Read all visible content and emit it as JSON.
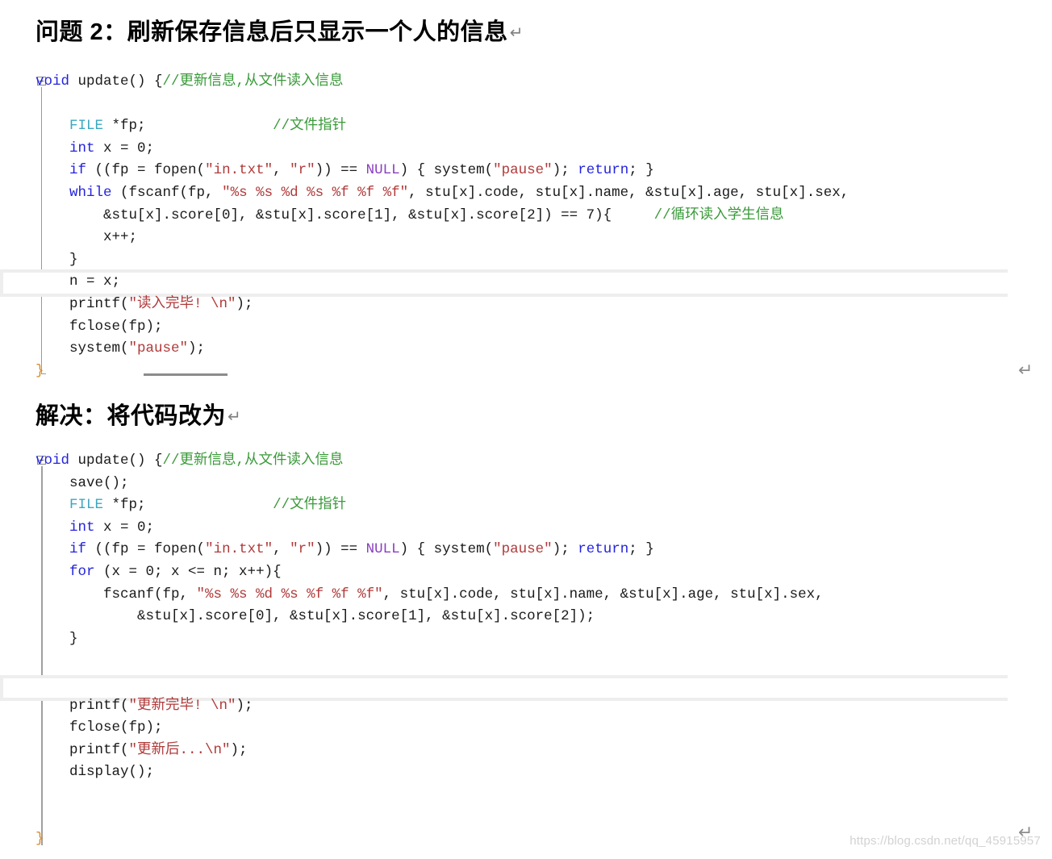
{
  "document": {
    "watermark": "https://blog.csdn.net/qq_45915957",
    "return_mark": "↵"
  },
  "headings": {
    "problem": "问题 2：刷新保存信息后只显示一个人的信息",
    "solution": "解决：将代码改为"
  },
  "code_block_1": {
    "name": "original-update-function",
    "lines": [
      [
        {
          "t": "void",
          "c": "kw"
        },
        {
          "t": " update() {",
          "c": "plain"
        },
        {
          "t": "//更新信息,从文件读入信息",
          "c": "cmt"
        }
      ],
      [],
      [
        {
          "t": "    ",
          "c": "plain"
        },
        {
          "t": "FILE",
          "c": "type"
        },
        {
          "t": " *fp;               ",
          "c": "plain"
        },
        {
          "t": "//文件指针",
          "c": "cmt"
        }
      ],
      [
        {
          "t": "    ",
          "c": "plain"
        },
        {
          "t": "int",
          "c": "kw"
        },
        {
          "t": " x = 0;",
          "c": "plain"
        }
      ],
      [
        {
          "t": "    ",
          "c": "plain"
        },
        {
          "t": "if",
          "c": "kw"
        },
        {
          "t": " ((fp = fopen(",
          "c": "plain"
        },
        {
          "t": "\"in.txt\"",
          "c": "str"
        },
        {
          "t": ", ",
          "c": "plain"
        },
        {
          "t": "\"r\"",
          "c": "str"
        },
        {
          "t": ")) == ",
          "c": "plain"
        },
        {
          "t": "NULL",
          "c": "macro"
        },
        {
          "t": ") { system(",
          "c": "plain"
        },
        {
          "t": "\"pause\"",
          "c": "str"
        },
        {
          "t": "); ",
          "c": "plain"
        },
        {
          "t": "return",
          "c": "kw"
        },
        {
          "t": "; }",
          "c": "plain"
        }
      ],
      [
        {
          "t": "    ",
          "c": "plain"
        },
        {
          "t": "while",
          "c": "kw"
        },
        {
          "t": " (fscanf(fp, ",
          "c": "plain"
        },
        {
          "t": "\"%s %s %d %s %f %f %f\"",
          "c": "str"
        },
        {
          "t": ", stu[x].code, stu[x].name, &stu[x].age, stu[x].sex,",
          "c": "plain"
        }
      ],
      [
        {
          "t": "        &stu[x].score[0], &stu[x].score[1], &stu[x].score[2]) == 7){     ",
          "c": "plain"
        },
        {
          "t": "//循环读入学生信息",
          "c": "cmt"
        }
      ],
      [
        {
          "t": "        x++;",
          "c": "plain"
        }
      ],
      [
        {
          "t": "    }",
          "c": "plain"
        }
      ],
      [
        {
          "t": "    n = x;",
          "c": "plain"
        }
      ],
      [
        {
          "t": "    printf(",
          "c": "plain"
        },
        {
          "t": "\"读入完毕! \\n\"",
          "c": "str"
        },
        {
          "t": ");",
          "c": "plain"
        }
      ],
      [
        {
          "t": "    fclose(fp);",
          "c": "plain"
        }
      ],
      [
        {
          "t": "    system(",
          "c": "plain"
        },
        {
          "t": "\"pause\"",
          "c": "str"
        },
        {
          "t": ");",
          "c": "plain"
        }
      ],
      [
        {
          "t": "}",
          "c": "brace"
        }
      ]
    ],
    "highlighted_line_index": 9,
    "highlighted_line_text": "n = x;"
  },
  "code_block_2": {
    "name": "fixed-update-function",
    "lines": [
      [
        {
          "t": "void",
          "c": "kw"
        },
        {
          "t": " update() {",
          "c": "plain"
        },
        {
          "t": "//更新信息,从文件读入信息",
          "c": "cmt"
        }
      ],
      [
        {
          "t": "    save();",
          "c": "plain"
        }
      ],
      [
        {
          "t": "    ",
          "c": "plain"
        },
        {
          "t": "FILE",
          "c": "type"
        },
        {
          "t": " *fp;               ",
          "c": "plain"
        },
        {
          "t": "//文件指针",
          "c": "cmt"
        }
      ],
      [
        {
          "t": "    ",
          "c": "plain"
        },
        {
          "t": "int",
          "c": "kw"
        },
        {
          "t": " x = 0;",
          "c": "plain"
        }
      ],
      [
        {
          "t": "    ",
          "c": "plain"
        },
        {
          "t": "if",
          "c": "kw"
        },
        {
          "t": " ((fp = fopen(",
          "c": "plain"
        },
        {
          "t": "\"in.txt\"",
          "c": "str"
        },
        {
          "t": ", ",
          "c": "plain"
        },
        {
          "t": "\"r\"",
          "c": "str"
        },
        {
          "t": ")) == ",
          "c": "plain"
        },
        {
          "t": "NULL",
          "c": "macro"
        },
        {
          "t": ") { system(",
          "c": "plain"
        },
        {
          "t": "\"pause\"",
          "c": "str"
        },
        {
          "t": "); ",
          "c": "plain"
        },
        {
          "t": "return",
          "c": "kw"
        },
        {
          "t": "; }",
          "c": "plain"
        }
      ],
      [
        {
          "t": "    ",
          "c": "plain"
        },
        {
          "t": "for",
          "c": "kw"
        },
        {
          "t": " (x = 0; x <= n; x++){",
          "c": "plain"
        }
      ],
      [
        {
          "t": "        fscanf(fp, ",
          "c": "plain"
        },
        {
          "t": "\"%s %s %d %s %f %f %f\"",
          "c": "str"
        },
        {
          "t": ", stu[x].code, stu[x].name, &stu[x].age, stu[x].sex,",
          "c": "plain"
        }
      ],
      [
        {
          "t": "            &stu[x].score[0], &stu[x].score[1], &stu[x].score[2]);",
          "c": "plain"
        }
      ],
      [
        {
          "t": "    }",
          "c": "plain"
        }
      ],
      [],
      [],
      [
        {
          "t": "    printf(",
          "c": "plain"
        },
        {
          "t": "\"更新完毕! \\n\"",
          "c": "str"
        },
        {
          "t": ");",
          "c": "plain"
        }
      ],
      [
        {
          "t": "    fclose(fp);",
          "c": "plain"
        }
      ],
      [
        {
          "t": "    printf(",
          "c": "plain"
        },
        {
          "t": "\"更新后...\\n\"",
          "c": "str"
        },
        {
          "t": ");",
          "c": "plain"
        }
      ],
      [
        {
          "t": "    display();",
          "c": "plain"
        }
      ],
      [],
      [],
      [
        {
          "t": "}",
          "c": "brace"
        }
      ]
    ],
    "highlighted_line_index": 10,
    "highlighted_line_text": ""
  },
  "colors": {
    "keyword": "#2323dc",
    "type": "#3aa8c1",
    "macro": "#8a3ec0",
    "string": "#b03a3a",
    "comment": "#3a9a3a",
    "plain": "#1a1a1a",
    "brace": "#d78b2e",
    "highlight_border": "#eeeeee",
    "guide_line": "#999999",
    "watermark": "#d2d2d2"
  }
}
